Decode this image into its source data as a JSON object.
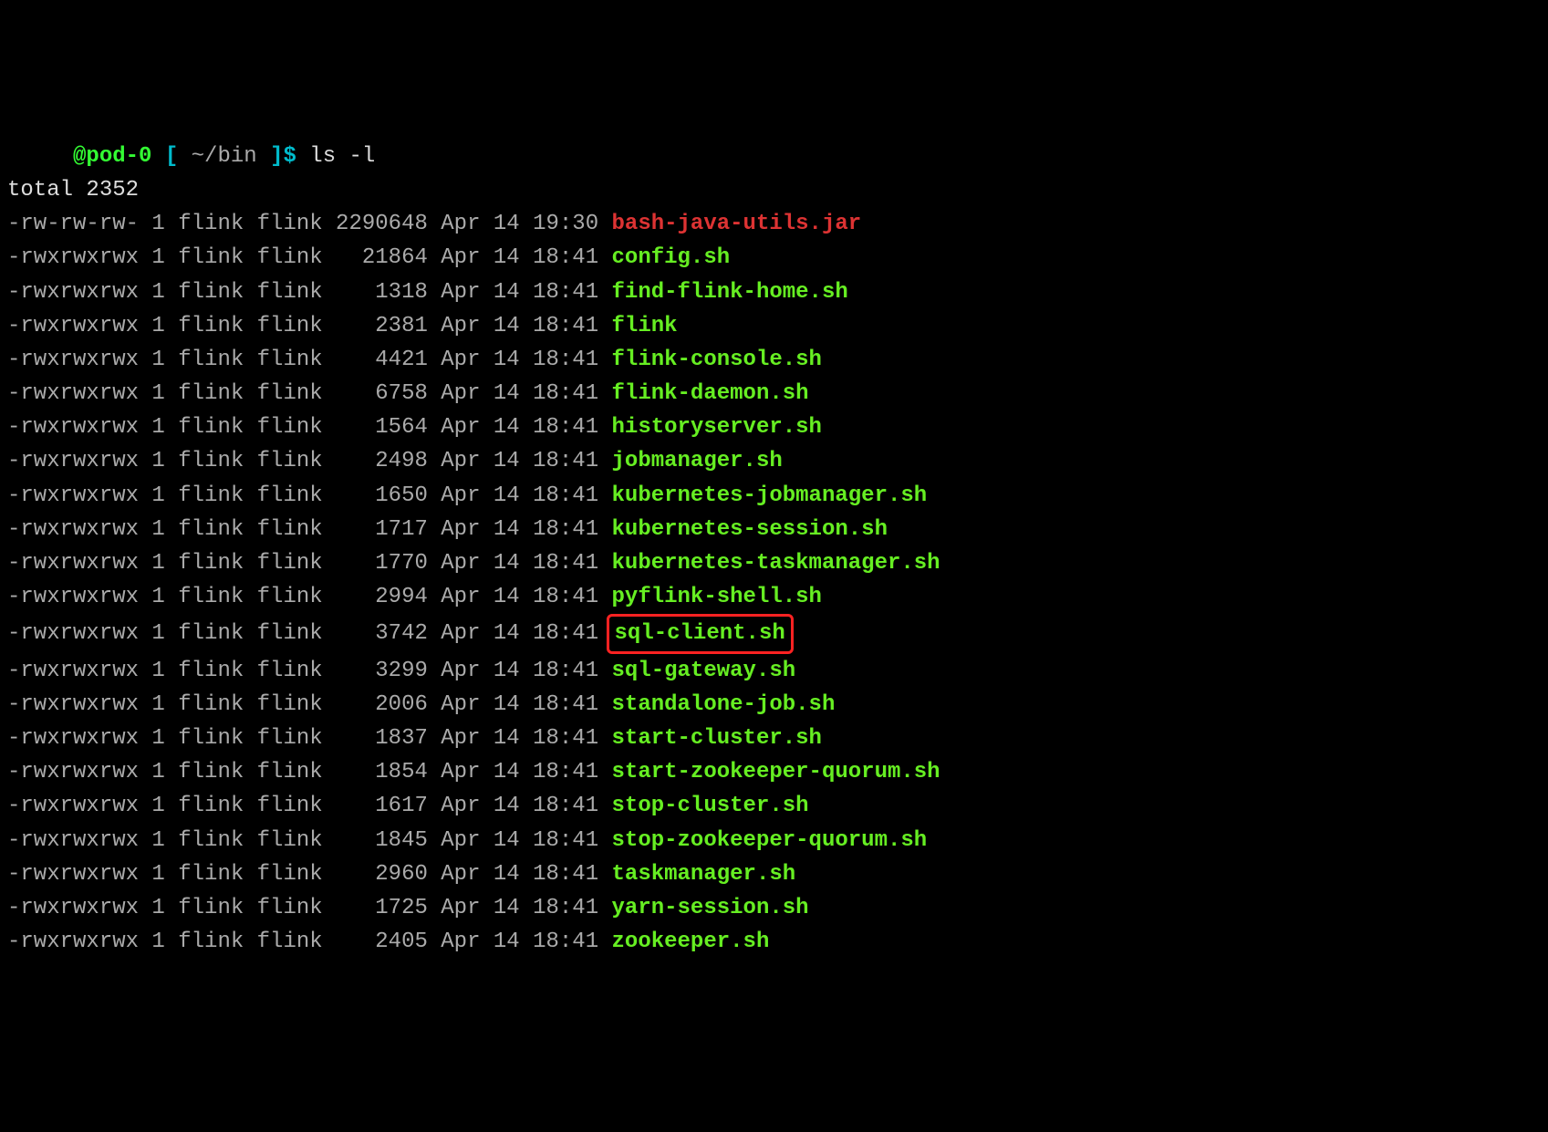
{
  "prompt": {
    "host": "@pod-0",
    "lbracket": "[",
    "path": "~/bin",
    "rbracket": "]",
    "dollar": "$",
    "command": "ls -l"
  },
  "total_line": "total 2352",
  "rows": [
    {
      "perms": "-rw-rw-rw-",
      "links": "1",
      "owner": "flink",
      "group": "flink",
      "size": "2290648",
      "month": "Apr",
      "day": "14",
      "time": "19:30",
      "name": "bash-java-utils.jar",
      "color": "red",
      "highlight": false
    },
    {
      "perms": "-rwxrwxrwx",
      "links": "1",
      "owner": "flink",
      "group": "flink",
      "size": "21864",
      "month": "Apr",
      "day": "14",
      "time": "18:41",
      "name": "config.sh",
      "color": "green",
      "highlight": false
    },
    {
      "perms": "-rwxrwxrwx",
      "links": "1",
      "owner": "flink",
      "group": "flink",
      "size": "1318",
      "month": "Apr",
      "day": "14",
      "time": "18:41",
      "name": "find-flink-home.sh",
      "color": "green",
      "highlight": false
    },
    {
      "perms": "-rwxrwxrwx",
      "links": "1",
      "owner": "flink",
      "group": "flink",
      "size": "2381",
      "month": "Apr",
      "day": "14",
      "time": "18:41",
      "name": "flink",
      "color": "green",
      "highlight": false
    },
    {
      "perms": "-rwxrwxrwx",
      "links": "1",
      "owner": "flink",
      "group": "flink",
      "size": "4421",
      "month": "Apr",
      "day": "14",
      "time": "18:41",
      "name": "flink-console.sh",
      "color": "green",
      "highlight": false
    },
    {
      "perms": "-rwxrwxrwx",
      "links": "1",
      "owner": "flink",
      "group": "flink",
      "size": "6758",
      "month": "Apr",
      "day": "14",
      "time": "18:41",
      "name": "flink-daemon.sh",
      "color": "green",
      "highlight": false
    },
    {
      "perms": "-rwxrwxrwx",
      "links": "1",
      "owner": "flink",
      "group": "flink",
      "size": "1564",
      "month": "Apr",
      "day": "14",
      "time": "18:41",
      "name": "historyserver.sh",
      "color": "green",
      "highlight": false
    },
    {
      "perms": "-rwxrwxrwx",
      "links": "1",
      "owner": "flink",
      "group": "flink",
      "size": "2498",
      "month": "Apr",
      "day": "14",
      "time": "18:41",
      "name": "jobmanager.sh",
      "color": "green",
      "highlight": false
    },
    {
      "perms": "-rwxrwxrwx",
      "links": "1",
      "owner": "flink",
      "group": "flink",
      "size": "1650",
      "month": "Apr",
      "day": "14",
      "time": "18:41",
      "name": "kubernetes-jobmanager.sh",
      "color": "green",
      "highlight": false
    },
    {
      "perms": "-rwxrwxrwx",
      "links": "1",
      "owner": "flink",
      "group": "flink",
      "size": "1717",
      "month": "Apr",
      "day": "14",
      "time": "18:41",
      "name": "kubernetes-session.sh",
      "color": "green",
      "highlight": false
    },
    {
      "perms": "-rwxrwxrwx",
      "links": "1",
      "owner": "flink",
      "group": "flink",
      "size": "1770",
      "month": "Apr",
      "day": "14",
      "time": "18:41",
      "name": "kubernetes-taskmanager.sh",
      "color": "green",
      "highlight": false
    },
    {
      "perms": "-rwxrwxrwx",
      "links": "1",
      "owner": "flink",
      "group": "flink",
      "size": "2994",
      "month": "Apr",
      "day": "14",
      "time": "18:41",
      "name": "pyflink-shell.sh",
      "color": "green",
      "highlight": false
    },
    {
      "perms": "-rwxrwxrwx",
      "links": "1",
      "owner": "flink",
      "group": "flink",
      "size": "3742",
      "month": "Apr",
      "day": "14",
      "time": "18:41",
      "name": "sql-client.sh",
      "color": "green",
      "highlight": true
    },
    {
      "perms": "-rwxrwxrwx",
      "links": "1",
      "owner": "flink",
      "group": "flink",
      "size": "3299",
      "month": "Apr",
      "day": "14",
      "time": "18:41",
      "name": "sql-gateway.sh",
      "color": "green",
      "highlight": false
    },
    {
      "perms": "-rwxrwxrwx",
      "links": "1",
      "owner": "flink",
      "group": "flink",
      "size": "2006",
      "month": "Apr",
      "day": "14",
      "time": "18:41",
      "name": "standalone-job.sh",
      "color": "green",
      "highlight": false
    },
    {
      "perms": "-rwxrwxrwx",
      "links": "1",
      "owner": "flink",
      "group": "flink",
      "size": "1837",
      "month": "Apr",
      "day": "14",
      "time": "18:41",
      "name": "start-cluster.sh",
      "color": "green",
      "highlight": false
    },
    {
      "perms": "-rwxrwxrwx",
      "links": "1",
      "owner": "flink",
      "group": "flink",
      "size": "1854",
      "month": "Apr",
      "day": "14",
      "time": "18:41",
      "name": "start-zookeeper-quorum.sh",
      "color": "green",
      "highlight": false
    },
    {
      "perms": "-rwxrwxrwx",
      "links": "1",
      "owner": "flink",
      "group": "flink",
      "size": "1617",
      "month": "Apr",
      "day": "14",
      "time": "18:41",
      "name": "stop-cluster.sh",
      "color": "green",
      "highlight": false
    },
    {
      "perms": "-rwxrwxrwx",
      "links": "1",
      "owner": "flink",
      "group": "flink",
      "size": "1845",
      "month": "Apr",
      "day": "14",
      "time": "18:41",
      "name": "stop-zookeeper-quorum.sh",
      "color": "green",
      "highlight": false
    },
    {
      "perms": "-rwxrwxrwx",
      "links": "1",
      "owner": "flink",
      "group": "flink",
      "size": "2960",
      "month": "Apr",
      "day": "14",
      "time": "18:41",
      "name": "taskmanager.sh",
      "color": "green",
      "highlight": false
    },
    {
      "perms": "-rwxrwxrwx",
      "links": "1",
      "owner": "flink",
      "group": "flink",
      "size": "1725",
      "month": "Apr",
      "day": "14",
      "time": "18:41",
      "name": "yarn-session.sh",
      "color": "green",
      "highlight": false
    },
    {
      "perms": "-rwxrwxrwx",
      "links": "1",
      "owner": "flink",
      "group": "flink",
      "size": "2405",
      "month": "Apr",
      "day": "14",
      "time": "18:41",
      "name": "zookeeper.sh",
      "color": "green",
      "highlight": false
    }
  ]
}
